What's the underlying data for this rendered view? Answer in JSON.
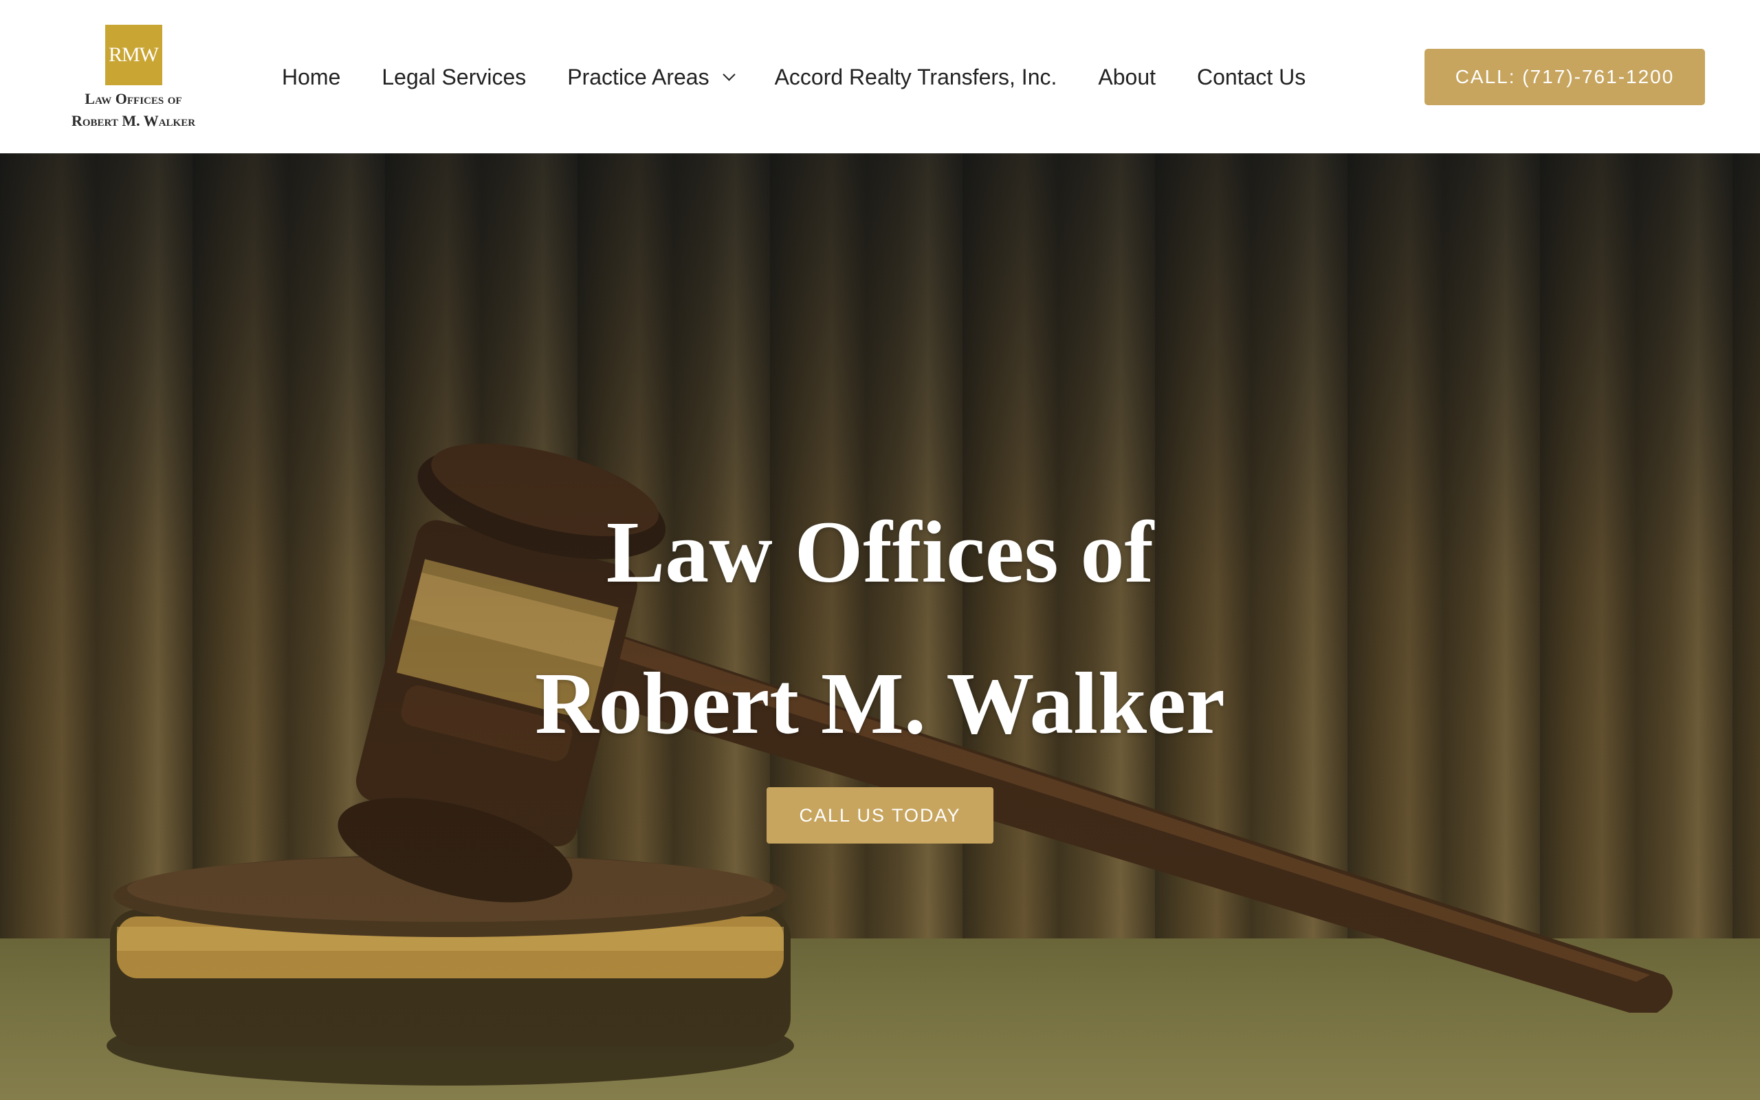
{
  "brand": {
    "logo_mark": "RMW",
    "logo_line_1": "Law Offices of",
    "logo_line_2": "Robert M. Walker",
    "accent_color": "#c9a533",
    "button_color": "#c7a55f"
  },
  "nav": {
    "items": [
      {
        "label": "Home"
      },
      {
        "label": "Legal Services"
      },
      {
        "label": "Practice Areas",
        "has_dropdown": true,
        "icon": "chevron-down-icon"
      },
      {
        "label": "Accord Realty Transfers, Inc."
      },
      {
        "label": "About"
      },
      {
        "label": "Contact Us"
      }
    ],
    "call_button": "CALL: (717)-761-1200"
  },
  "hero": {
    "title_line_1": "Law Offices of",
    "title_line_2": "Robert M. Walker",
    "cta_label": "CALL US TODAY",
    "background": "gavel-on-desk-with-law-books-photo"
  }
}
